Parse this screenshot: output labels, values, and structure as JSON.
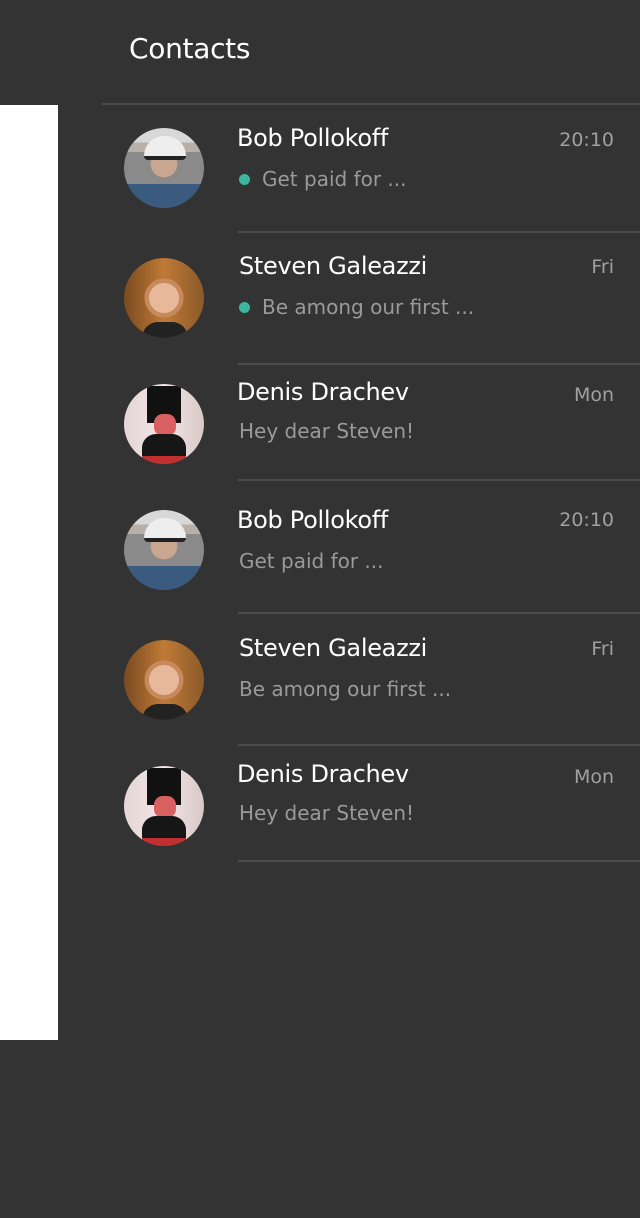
{
  "header": {
    "title": "Contacts"
  },
  "colors": {
    "background": "#333333",
    "unread_dot": "#3fb59d",
    "divider": "#4a4a4a"
  },
  "contacts": [
    {
      "name": "Bob Pollokoff",
      "time": "20:10",
      "preview": "Get paid for ...",
      "unread": true,
      "avatar": "bob"
    },
    {
      "name": "Steven Galeazzi",
      "time": "Fri",
      "preview": "Be among our first ...",
      "unread": true,
      "avatar": "steven"
    },
    {
      "name": "Denis Drachev",
      "time": "Mon",
      "preview": "Hey dear Steven!",
      "unread": false,
      "avatar": "denis"
    },
    {
      "name": "Bob Pollokoff",
      "time": "20:10",
      "preview": "Get paid for ...",
      "unread": false,
      "avatar": "bob"
    },
    {
      "name": "Steven Galeazzi",
      "time": "Fri",
      "preview": "Be among our first ...",
      "unread": false,
      "avatar": "steven"
    },
    {
      "name": "Denis Drachev",
      "time": "Mon",
      "preview": "Hey dear Steven!",
      "unread": false,
      "avatar": "denis"
    }
  ]
}
